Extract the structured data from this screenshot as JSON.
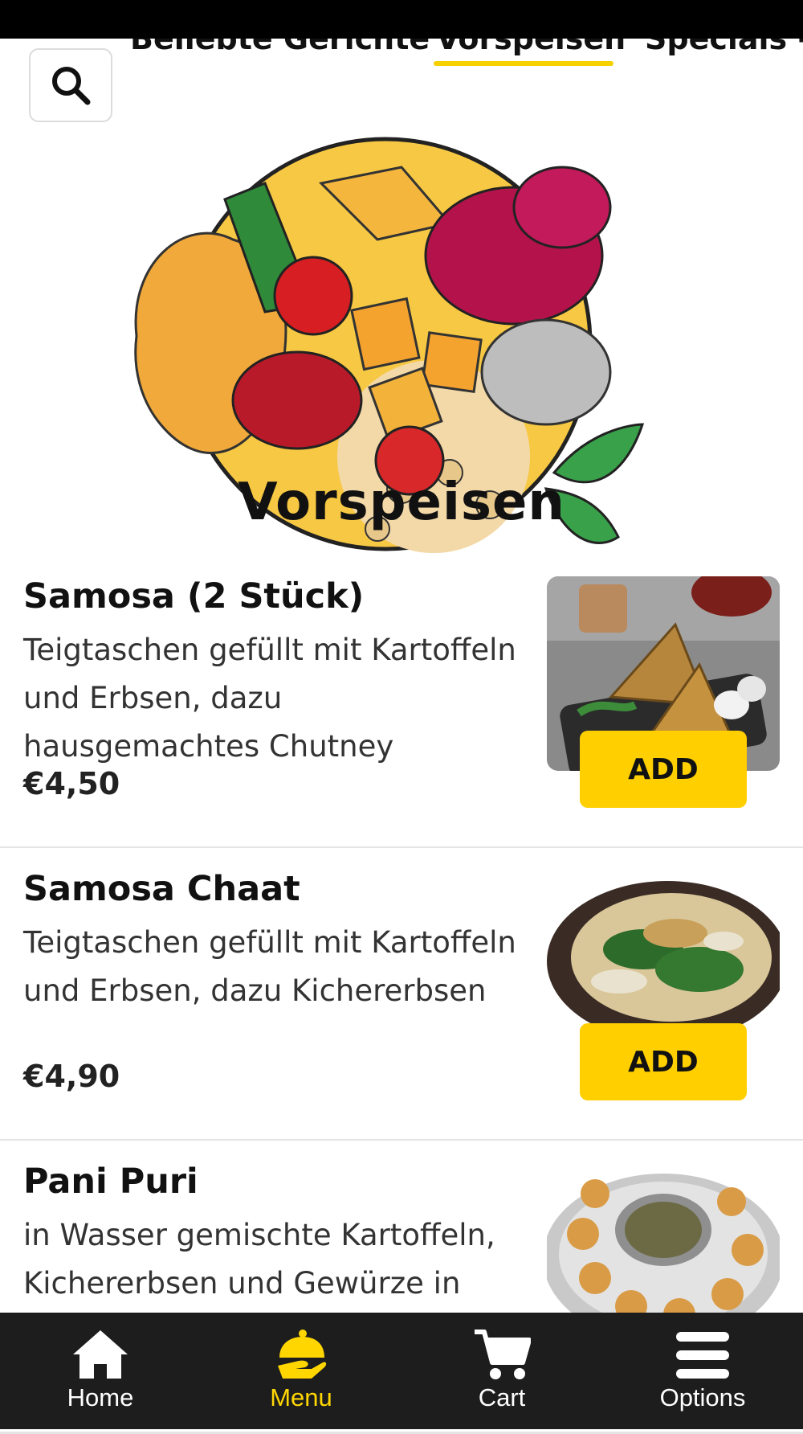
{
  "category_tabs": [
    {
      "label": "Beliebte Gerichte",
      "active": false
    },
    {
      "label": "Vorspeisen",
      "active": true
    },
    {
      "label": "Specials -",
      "active": false
    }
  ],
  "hero": {
    "title": "Vorspeisen"
  },
  "items": [
    {
      "name": "Samosa (2 Stück)",
      "description": "Teigtaschen gefüllt mit Kartoffeln und Erbsen, dazu hausgemachtes Chutney",
      "price": "€4,50",
      "add_label": "ADD",
      "image": "samosa-photo"
    },
    {
      "name": "Samosa Chaat",
      "description": "Teigtaschen gefüllt mit Kartoffeln und Erbsen, dazu Kichererbsen",
      "price": "€4,90",
      "add_label": "ADD",
      "image": "samosa-chaat-photo"
    },
    {
      "name": "Pani Puri",
      "description": "in Wasser gemischte Kartoffeln, Kichererbsen und Gewürze in",
      "price": "",
      "add_label": "",
      "image": "pani-puri-photo"
    }
  ],
  "bottom_nav": [
    {
      "label": "Home",
      "icon": "home-icon",
      "active": false
    },
    {
      "label": "Menu",
      "icon": "cloche-icon",
      "active": true
    },
    {
      "label": "Cart",
      "icon": "cart-icon",
      "active": false
    },
    {
      "label": "Options",
      "icon": "hamburger-icon",
      "active": false
    }
  ],
  "colors": {
    "accent": "#ffcf00",
    "nav_background": "#1d1d1d",
    "active_nav": "#ffd600"
  }
}
